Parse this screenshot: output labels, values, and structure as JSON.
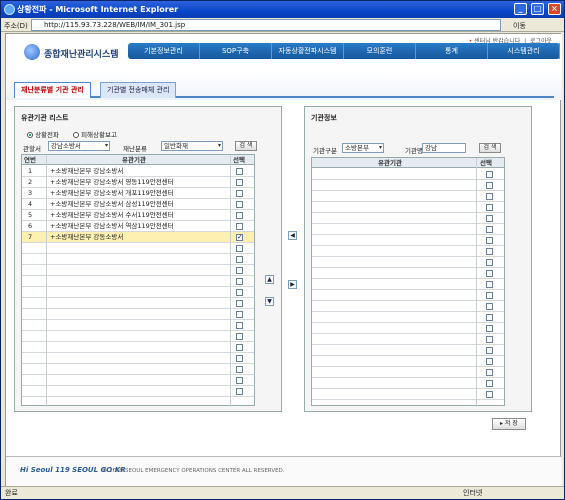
{
  "window": {
    "title": "상황전파 - Microsoft Internet Explorer"
  },
  "addressbar": {
    "label": "주소(D)",
    "url": "http://115.93.73.228/WEB/IM/IM_301.jsp",
    "go": "이동"
  },
  "header": {
    "logo_text": "종합재난관리시스템",
    "welcome": "센터님 반갑습니다",
    "logout": "로그아웃",
    "nav": [
      "기본정보관리",
      "SOP구축",
      "자동상황전파시스템",
      "모의훈련",
      "통계",
      "시스템관리"
    ]
  },
  "tabs": {
    "active": "재난분류별 기관 관리",
    "inactive": "기관별 전송매체 관리"
  },
  "left": {
    "title": "유관기관 리스트",
    "radio1": "상황전파",
    "radio2": "피해상황보고",
    "select1_label": "관할서",
    "select1_value": "강남소방서",
    "select2_label": "재난분류",
    "select2_value": "일반화재",
    "search_btn": "검 색",
    "col_no": "연번",
    "col_agency": "유관기관",
    "col_select": "선택",
    "rows": [
      {
        "no": "1",
        "name": "+소방재난본부 강남소방서",
        "checked": false
      },
      {
        "no": "2",
        "name": "+소방재난본부 강남소방서 영동119안전센터",
        "checked": false
      },
      {
        "no": "3",
        "name": "+소방재난본부 강남소방서 개포119안전센터",
        "checked": false
      },
      {
        "no": "4",
        "name": "+소방재난본부 강남소방서 삼성119안전센터",
        "checked": false
      },
      {
        "no": "5",
        "name": "+소방재난본부 강남소방서 수서119안전센터",
        "checked": false
      },
      {
        "no": "6",
        "name": "+소방재난본부 강남소방서 역삼119안전센터",
        "checked": false
      },
      {
        "no": "7",
        "name": "+소방재난본부 강동소방서",
        "checked": true
      }
    ]
  },
  "right": {
    "title": "기관정보",
    "kind_label": "기관구분",
    "kind_value": "소방본부",
    "name_label": "기관명",
    "name_value": "강남",
    "search_btn": "검 색",
    "col_agency": "유관기관",
    "col_select": "선택"
  },
  "arrows": {
    "up": "▲",
    "down": "▼",
    "left": "◀",
    "right": "▶"
  },
  "save_btn": "저 장",
  "footer": {
    "brand": "Hi Seoul 119 SEOUL GO·KR",
    "copy": "© 2009 SEOUL EMERGENCY OPERATIONS CENTER ALL RESERVED."
  },
  "status": {
    "left": "완료",
    "right": "인터넷"
  }
}
